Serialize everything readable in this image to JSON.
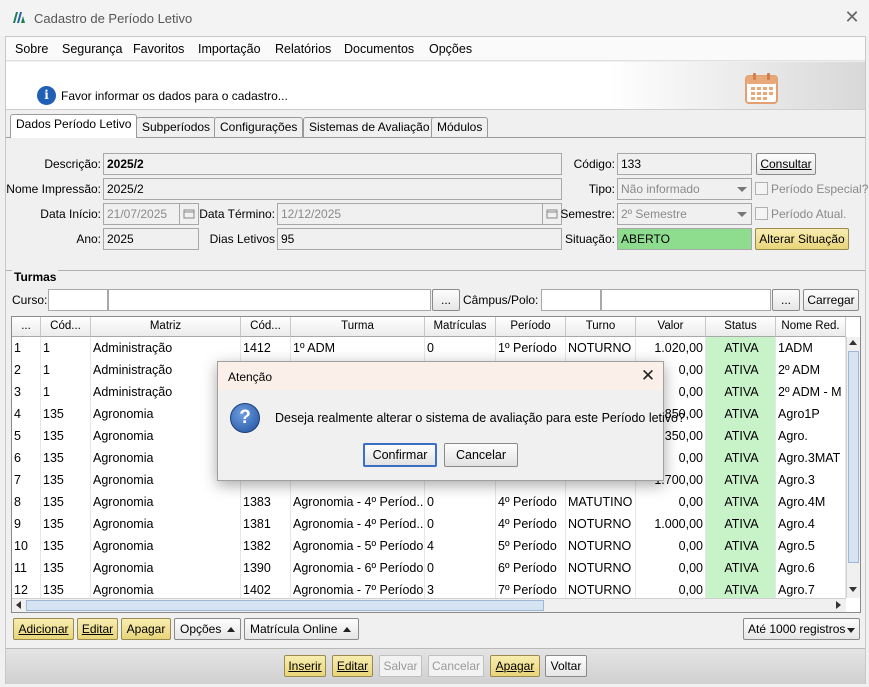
{
  "window": {
    "title": "Cadastro de Período Letivo"
  },
  "menu": [
    "Sobre",
    "Segurança",
    "Favoritos",
    "Importação",
    "Relatórios",
    "Documentos",
    "Opções"
  ],
  "info": {
    "message": "Favor informar os dados para o cadastro..."
  },
  "tabs": [
    "Dados Período Letivo",
    "Subperíodos",
    "Configurações",
    "Sistemas de Avaliação",
    "Módulos"
  ],
  "form": {
    "descricao_label": "Descrição:",
    "descricao": "2025/2",
    "nome_impressao_label": "Nome Impressão:",
    "nome_impressao": "2025/2",
    "data_inicio_label": "Data Início:",
    "data_inicio": "21/07/2025",
    "data_termino_label": "Data Término:",
    "data_termino": "12/12/2025",
    "ano_label": "Ano:",
    "ano": "2025",
    "dias_letivos_label": "Dias Letivos",
    "dias_letivos": "95",
    "codigo_label": "Código:",
    "codigo": "133",
    "consultar": "Consultar",
    "tipo_label": "Tipo:",
    "tipo": "Não informado",
    "periodo_especial": "Período Especial?",
    "semestre_label": "Semestre:",
    "semestre": "2º Semestre",
    "periodo_atual": "Período Atual.",
    "situacao_label": "Situação:",
    "situacao": "ABERTO",
    "alterar_situacao": "Alterar Situação"
  },
  "turmas": {
    "group_label": "Turmas",
    "curso_label": "Curso:",
    "campus_label": "Câmpus/Polo:",
    "ellipsis": "...",
    "carregar": "Carregar",
    "columns": [
      "...",
      "Cód...",
      "Matriz",
      "Cód...",
      "Turma",
      "Matrículas",
      "Período",
      "Turno",
      "Valor",
      "Status",
      "Nome Red."
    ],
    "rows": [
      [
        "1",
        "1",
        "Administração",
        "1412",
        "1º ADM",
        "0",
        "1º Período",
        "NOTURNO",
        "1.020,00",
        "ATIVA",
        "1ADM"
      ],
      [
        "2",
        "1",
        "Administração",
        "",
        "",
        "",
        "",
        "",
        "0,00",
        "ATIVA",
        "2º ADM"
      ],
      [
        "3",
        "1",
        "Administração",
        "",
        "",
        "",
        "",
        "",
        "0,00",
        "ATIVA",
        "2º ADM - M"
      ],
      [
        "4",
        "135",
        "Agronomia",
        "",
        "",
        "",
        "",
        "",
        "1.850,00",
        "ATIVA",
        "Agro1P"
      ],
      [
        "5",
        "135",
        "Agronomia",
        "",
        "",
        "",
        "",
        "",
        "2.350,00",
        "ATIVA",
        "Agro."
      ],
      [
        "6",
        "135",
        "Agronomia",
        "",
        "",
        "",
        "",
        "",
        "0,00",
        "ATIVA",
        "Agro.3MAT"
      ],
      [
        "7",
        "135",
        "Agronomia",
        "",
        "",
        "",
        "",
        "",
        "1.700,00",
        "ATIVA",
        "Agro.3"
      ],
      [
        "8",
        "135",
        "Agronomia",
        "1383",
        "Agronomia - 4º Períod...",
        "0",
        "4º Período",
        "MATUTINO",
        "0,00",
        "ATIVA",
        "Agro.4M"
      ],
      [
        "9",
        "135",
        "Agronomia",
        "1381",
        "Agronomia - 4º Períod...",
        "0",
        "4º Período",
        "NOTURNO",
        "1.000,00",
        "ATIVA",
        "Agro.4"
      ],
      [
        "10",
        "135",
        "Agronomia",
        "1382",
        "Agronomia - 5º Período",
        "4",
        "5º Período",
        "NOTURNO",
        "0,00",
        "ATIVA",
        "Agro.5"
      ],
      [
        "11",
        "135",
        "Agronomia",
        "1390",
        "Agronomia - 6º Período",
        "0",
        "6º Período",
        "NOTURNO",
        "0,00",
        "ATIVA",
        "Agro.6"
      ],
      [
        "12",
        "135",
        "Agronomia",
        "1402",
        "Agronomia - 7º Período",
        "3",
        "7º Período",
        "NOTURNO",
        "0,00",
        "ATIVA",
        "Agro.7"
      ]
    ]
  },
  "actions": {
    "adicionar": "Adicionar",
    "editar": "Editar",
    "apagar": "Apagar",
    "opcoes": "Opções",
    "matricula_online": "Matrícula Online",
    "registros": "Até 1000 registros"
  },
  "bottom": {
    "inserir": "Inserir",
    "editar": "Editar",
    "salvar": "Salvar",
    "cancelar": "Cancelar",
    "apagar": "Apagar",
    "voltar": "Voltar"
  },
  "dialog": {
    "title": "Atenção",
    "message": "Deseja realmente alterar o sistema de avaliação para este Período letivo?",
    "confirm": "Confirmar",
    "cancel": "Cancelar"
  },
  "colors": {
    "status_bg": "#c8f2c8",
    "situacao_bg": "#8edc8e",
    "highlight_button": "#f0e09a",
    "dialog_title": "#fbf0e9"
  },
  "icons": {
    "app": "app-logo-icon",
    "info": "info-icon",
    "calendar": "calendar-icon",
    "question": "question-icon"
  }
}
